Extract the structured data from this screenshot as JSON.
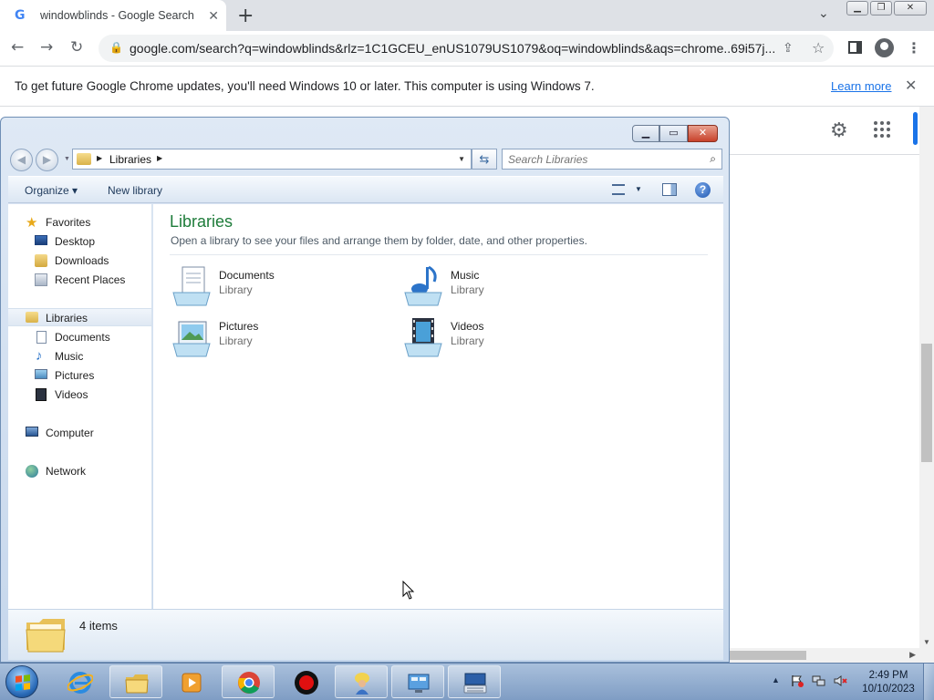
{
  "browser": {
    "tab": {
      "favicon": "G",
      "title": "windowblinds - Google Search"
    },
    "new_tab_icon": "+",
    "url": "google.com/search?q=windowblinds&rlz=1C1GCEU_enUS1079US1079&oq=windowblinds&aqs=chrome..69i57j...",
    "infobar": {
      "message": "To get future Google Chrome updates, you'll need Windows 10 or later. This computer is using Windows 7.",
      "link": "Learn more"
    }
  },
  "explorer": {
    "address": {
      "crumb": "Libraries"
    },
    "search": {
      "placeholder": "Search Libraries"
    },
    "commands": {
      "organize": "Organize ▾",
      "new_library": "New library"
    },
    "navigation": {
      "favorites": {
        "label": "Favorites",
        "items": [
          "Desktop",
          "Downloads",
          "Recent Places"
        ]
      },
      "libraries": {
        "label": "Libraries",
        "items": [
          "Documents",
          "Music",
          "Pictures",
          "Videos"
        ]
      },
      "computer": "Computer",
      "network": "Network"
    },
    "content": {
      "heading": "Libraries",
      "subtitle": "Open a library to see your files and arrange them by folder, date, and other properties.",
      "libraries": [
        {
          "name": "Documents",
          "type": "Library",
          "icon": "documents-library-icon"
        },
        {
          "name": "Music",
          "type": "Library",
          "icon": "music-library-icon"
        },
        {
          "name": "Pictures",
          "type": "Library",
          "icon": "pictures-library-icon"
        },
        {
          "name": "Videos",
          "type": "Library",
          "icon": "videos-library-icon"
        }
      ]
    },
    "details": {
      "count": "4 items"
    }
  },
  "taskbar": {
    "apps": [
      "internet-explorer-icon",
      "windows-explorer-icon",
      "media-player-icon",
      "chrome-icon",
      "record-icon",
      "user-accounts-icon",
      "control-panel-icon",
      "on-screen-keyboard-icon"
    ],
    "clock": {
      "time": "2:49 PM",
      "date": "10/10/2023"
    }
  },
  "colors": {
    "link_blue": "#1a73e8",
    "library_heading_green": "#1e7c3a",
    "close_red": "#c8412a"
  }
}
